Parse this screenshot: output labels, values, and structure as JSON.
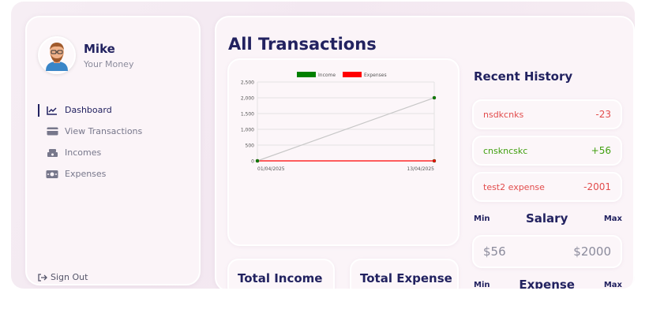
{
  "user": {
    "name": "Mike",
    "subtitle": "Your Money"
  },
  "nav": [
    {
      "label": "Dashboard",
      "icon": "chart-line-icon",
      "active": true
    },
    {
      "label": "View Transactions",
      "icon": "credit-card-icon",
      "active": false
    },
    {
      "label": "Incomes",
      "icon": "money-stack-icon",
      "active": false
    },
    {
      "label": "Expenses",
      "icon": "money-bill-icon",
      "active": false
    }
  ],
  "signout_label": "Sign Out",
  "main": {
    "title": "All Transactions",
    "total_income_label": "Total Income",
    "total_expense_label": "Total Expense"
  },
  "chart_data": {
    "type": "line",
    "x": [
      "01/04/2025",
      "13/04/2025"
    ],
    "series": [
      {
        "name": "Income",
        "color": "#008000",
        "values": [
          0,
          2000
        ]
      },
      {
        "name": "Expenses",
        "color": "#ff0000",
        "values": [
          0,
          0
        ]
      }
    ],
    "ylim": [
      0,
      2500
    ],
    "yticks": [
      "0",
      "500",
      "1,000",
      "1,500",
      "2,000",
      "2,500"
    ],
    "legend": "top-center",
    "grid": true
  },
  "history": {
    "title": "Recent History",
    "items": [
      {
        "name": "nsdkcnks",
        "amount": "-23",
        "type": "expense"
      },
      {
        "name": "cnskncskc",
        "amount": "+56",
        "type": "income"
      },
      {
        "name": "test2 expense",
        "amount": "-2001",
        "type": "expense"
      }
    ]
  },
  "salary": {
    "min_label": "Min",
    "label": "Salary",
    "max_label": "Max",
    "min": "$56",
    "max": "$2000"
  },
  "expense_range": {
    "min_label": "Min",
    "label": "Expense",
    "max_label": "Max"
  },
  "colors": {
    "primary": "#222260",
    "income": "#41a010",
    "expense": "#e24c4c"
  }
}
